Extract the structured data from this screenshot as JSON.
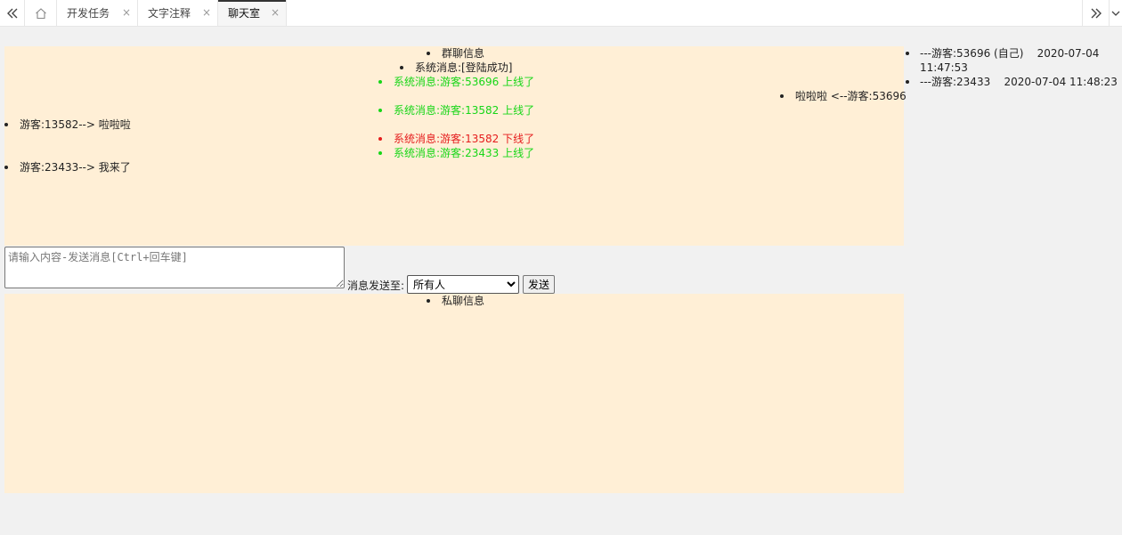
{
  "tabbar": {
    "nav_left_icon": "double-chevron-left-icon",
    "home_icon": "home-icon",
    "tabs": [
      {
        "label": "开发任务",
        "close": "×"
      },
      {
        "label": "文字注释",
        "close": "×"
      },
      {
        "label": "聊天室",
        "close": "×",
        "active": true
      }
    ],
    "nav_right_icon": "double-chevron-right-icon",
    "dropdown_icon": "chevron-down-icon"
  },
  "group_chat": {
    "header": "群聊信息",
    "messages": [
      {
        "text": "系统消息:[登陆成功]",
        "align": "center",
        "color": "default"
      },
      {
        "text": "系统消息:游客:53696 上线了",
        "align": "center",
        "color": "green"
      },
      {
        "text": "啦啦啦 <--游客:53696",
        "align": "right",
        "color": "default"
      },
      {
        "text": "系统消息:游客:13582 上线了",
        "align": "center",
        "color": "green"
      },
      {
        "text": "游客:13582--> 啦啦啦",
        "align": "left",
        "color": "default"
      },
      {
        "text": "系统消息:游客:13582 下线了",
        "align": "center",
        "color": "red"
      },
      {
        "text": "系统消息:游客:23433 上线了",
        "align": "center",
        "color": "green"
      },
      {
        "text": "游客:23433--> 我来了",
        "align": "left",
        "color": "default"
      }
    ]
  },
  "online_users": [
    {
      "text": "---游客:53696 (自己)    2020-07-04 11:47:53"
    },
    {
      "text": "---游客:23433    2020-07-04 11:48:23"
    }
  ],
  "composer": {
    "placeholder": "请输入内容-发送消息[Ctrl+回车键]",
    "value": "",
    "send_to_label": "消息发送至:",
    "target_selected": "所有人",
    "send_button": "发送"
  },
  "private_chat": {
    "header": "私聊信息"
  },
  "colors": {
    "panel_bg": "#ffefd6",
    "page_bg": "#f1f1f1",
    "online": "#17d617",
    "offline": "#e51d1d"
  }
}
